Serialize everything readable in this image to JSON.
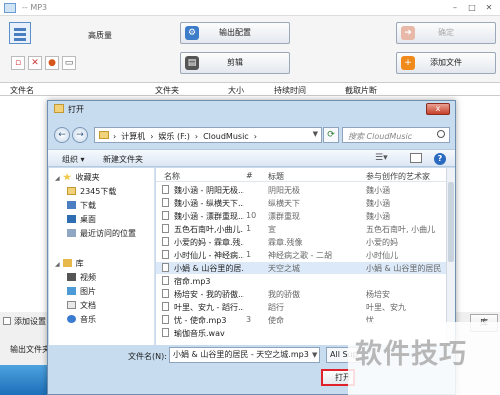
{
  "main": {
    "title": "-- MP3",
    "quality_label": "高质量",
    "output_config_label": "输出配置",
    "confirm_label": "确定",
    "clip_label": "剪辑",
    "add_file_label": "添加文件",
    "columns": [
      "文件名",
      "文件夹",
      "大小",
      "持续时间",
      "截取片断"
    ],
    "bottom_option_label": "添加设置",
    "output_folder_label": "输出文件夹",
    "right_button_peek": "库"
  },
  "dialog": {
    "title": "打开",
    "close_label": "x",
    "breadcrumbs": [
      "计算机",
      "娱乐 (F:)",
      "CloudMusic"
    ],
    "search_placeholder": "搜索 CloudMusic",
    "organize_label": "组织 ▾",
    "new_folder_label": "新建文件夹",
    "nav": {
      "favorites_label": "收藏夹",
      "favorites": [
        "2345下载",
        "下载",
        "桌面",
        "最近访问的位置"
      ],
      "library_label": "库",
      "library": [
        "视频",
        "图片",
        "文档",
        "音乐"
      ]
    },
    "file_columns": [
      "名称",
      "#",
      "标题",
      "参与创作的艺术家"
    ],
    "files": [
      {
        "name": "魏小涵 - 阴阳无极...",
        "num": "",
        "title": "阴阳无极",
        "artist": "魏小涵"
      },
      {
        "name": "魏小涵 - 纵横天下...",
        "num": "",
        "title": "纵横天下",
        "artist": "魏小涵"
      },
      {
        "name": "魏小涵 - 漂群重现...",
        "num": "10",
        "title": "漂群重现",
        "artist": "魏小涵"
      },
      {
        "name": "五色石南叶,小曲儿...",
        "num": "1",
        "title": "宣",
        "artist": "五色石南叶, 小曲儿"
      },
      {
        "name": "小爱的妈 - 霖章.残...",
        "num": "",
        "title": "霖章.残像",
        "artist": "小爱的妈"
      },
      {
        "name": "小时仙儿 - 神经病...",
        "num": "1",
        "title": "神经病之歌 - 二胡",
        "artist": "小时仙儿"
      },
      {
        "name": "小娟 & 山谷里的居...",
        "num": "",
        "title": "天空之城",
        "artist": "小娟 & 山谷里的居民"
      },
      {
        "name": "宿命.mp3",
        "num": "",
        "title": "",
        "artist": ""
      },
      {
        "name": "杨培安 - 我的骄傲...",
        "num": "",
        "title": "我的骄傲",
        "artist": "杨培安"
      },
      {
        "name": "叶里、安九 - 蹈行...",
        "num": "",
        "title": "蹈行",
        "artist": "叶里、安九"
      },
      {
        "name": "忧 - 使命.mp3",
        "num": "3",
        "title": "使命",
        "artist": "忧"
      },
      {
        "name": "瑜伽音乐.wav",
        "num": "",
        "title": "",
        "artist": ""
      }
    ],
    "filename_label": "文件名(N):",
    "filename_value": "小娟 & 山谷里的居民 - 天空之城.mp3",
    "filetype_value": "All Sup",
    "open_label": "打开"
  },
  "watermark": "软件技巧"
}
